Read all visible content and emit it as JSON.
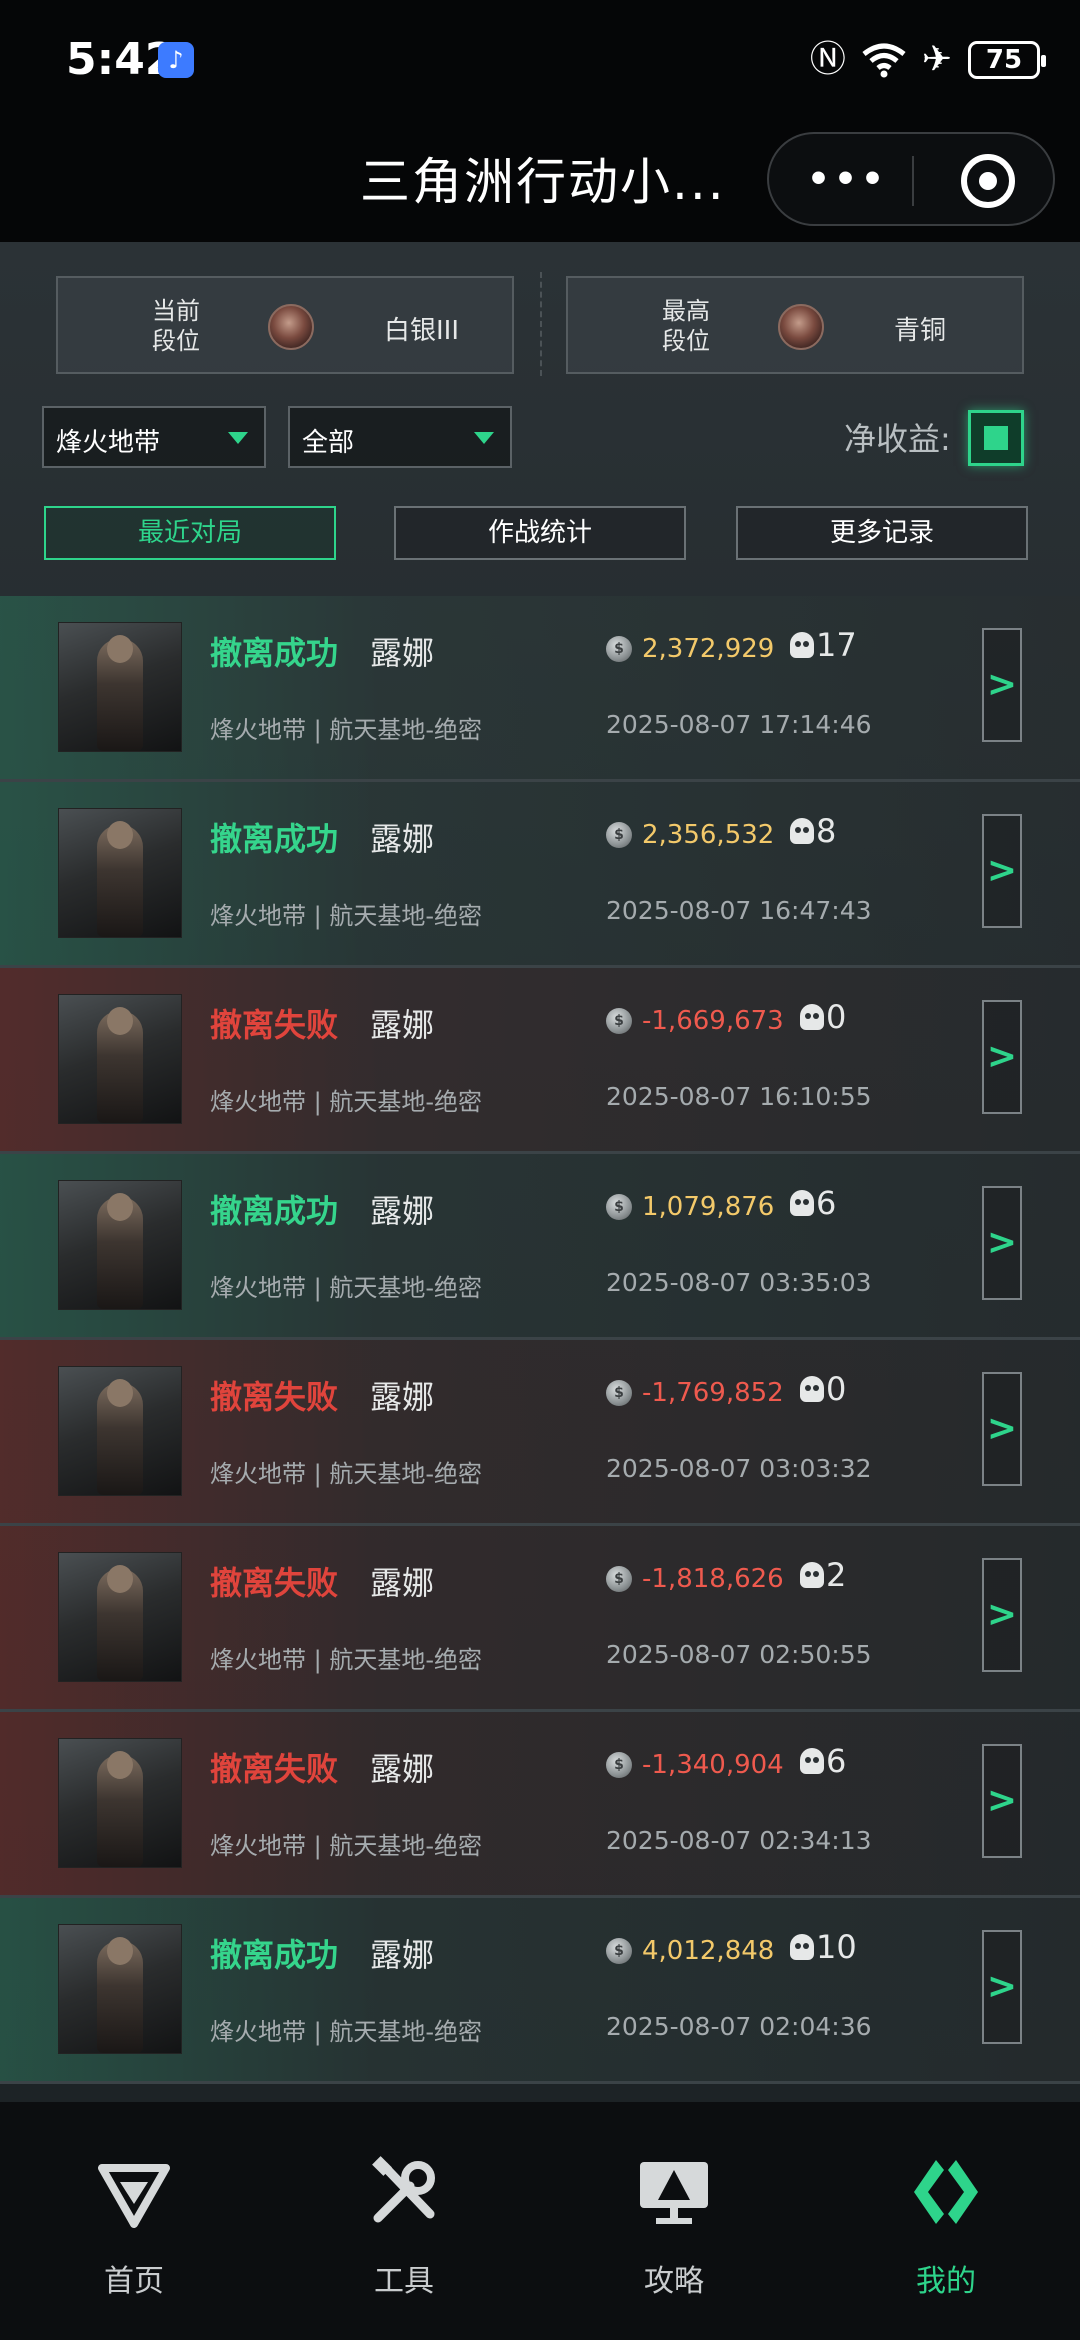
{
  "status_bar": {
    "time": "5:42",
    "battery": "75"
  },
  "nav": {
    "title": "三角洲行动小...",
    "more": "•••"
  },
  "rank": {
    "current": {
      "label": "当前段位",
      "value": "白银III"
    },
    "highest": {
      "label": "最高段位",
      "value": "青铜"
    }
  },
  "filters": {
    "mode": "烽火地带",
    "scope": "全部",
    "net_label": "净收益:",
    "net_checked": true
  },
  "tabs": [
    {
      "label": "最近对局",
      "active": true
    },
    {
      "label": "作战统计",
      "active": false
    },
    {
      "label": "更多记录",
      "active": false
    }
  ],
  "matches": [
    {
      "result": "撤离成功",
      "win": true,
      "operator": "露娜",
      "value": "2,372,929",
      "kills": "17",
      "map": "烽火地带 | 航天基地-绝密",
      "time": "2025-08-07 17:14:46"
    },
    {
      "result": "撤离成功",
      "win": true,
      "operator": "露娜",
      "value": "2,356,532",
      "kills": "8",
      "map": "烽火地带 | 航天基地-绝密",
      "time": "2025-08-07 16:47:43"
    },
    {
      "result": "撤离失败",
      "win": false,
      "operator": "露娜",
      "value": "-1,669,673",
      "kills": "0",
      "map": "烽火地带 | 航天基地-绝密",
      "time": "2025-08-07 16:10:55"
    },
    {
      "result": "撤离成功",
      "win": true,
      "operator": "露娜",
      "value": "1,079,876",
      "kills": "6",
      "map": "烽火地带 | 航天基地-绝密",
      "time": "2025-08-07 03:35:03"
    },
    {
      "result": "撤离失败",
      "win": false,
      "operator": "露娜",
      "value": "-1,769,852",
      "kills": "0",
      "map": "烽火地带 | 航天基地-绝密",
      "time": "2025-08-07 03:03:32"
    },
    {
      "result": "撤离失败",
      "win": false,
      "operator": "露娜",
      "value": "-1,818,626",
      "kills": "2",
      "map": "烽火地带 | 航天基地-绝密",
      "time": "2025-08-07 02:50:55"
    },
    {
      "result": "撤离失败",
      "win": false,
      "operator": "露娜",
      "value": "-1,340,904",
      "kills": "6",
      "map": "烽火地带 | 航天基地-绝密",
      "time": "2025-08-07 02:34:13"
    },
    {
      "result": "撤离成功",
      "win": true,
      "operator": "露娜",
      "value": "4,012,848",
      "kills": "10",
      "map": "烽火地带 | 航天基地-绝密",
      "time": "2025-08-07 02:04:36"
    }
  ],
  "bottom_tabs": [
    {
      "label": "首页",
      "icon": "home-logo-icon",
      "active": false
    },
    {
      "label": "工具",
      "icon": "tools-icon",
      "active": false
    },
    {
      "label": "攻略",
      "icon": "guide-icon",
      "active": false
    },
    {
      "label": "我的",
      "icon": "profile-icon",
      "active": true
    }
  ],
  "colors": {
    "accent": "#2ed48b",
    "win": "#35d58c",
    "lose": "#e0443c",
    "gain": "#f3c96a",
    "loss": "#ef5a4e"
  }
}
